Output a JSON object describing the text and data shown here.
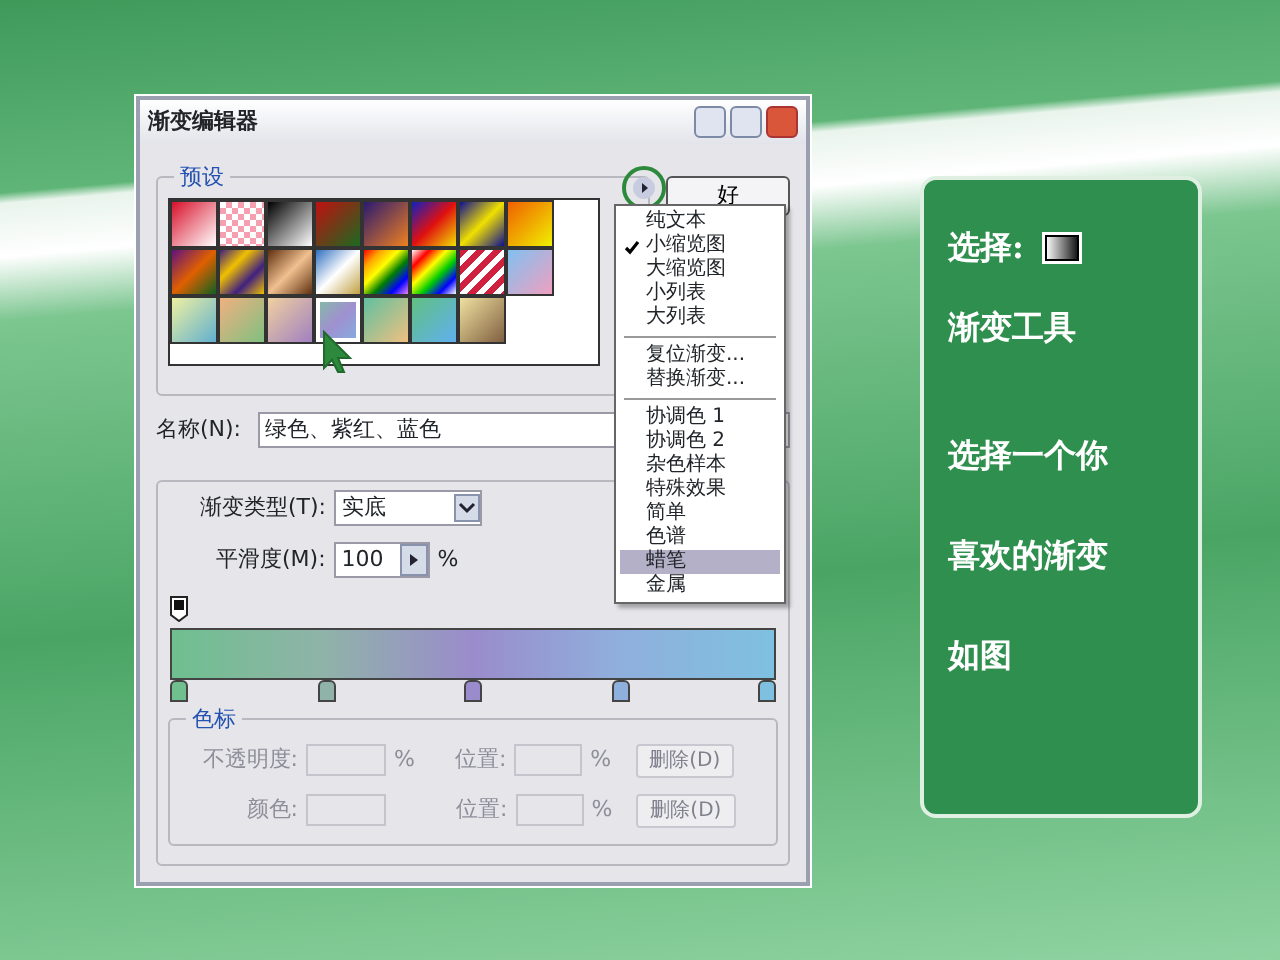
{
  "dialog": {
    "title": "渐变编辑器",
    "presets": {
      "legend": "预设",
      "items": [
        {
          "selected": false
        },
        {
          "selected": false
        },
        {
          "selected": false
        },
        {
          "selected": false
        },
        {
          "selected": false
        },
        {
          "selected": false
        },
        {
          "selected": false
        },
        {
          "selected": false
        },
        {
          "selected": false
        },
        {
          "selected": false
        },
        {
          "selected": false
        },
        {
          "selected": false
        },
        {
          "selected": false
        },
        {
          "selected": false
        },
        {
          "selected": false
        },
        {
          "selected": false
        },
        {
          "selected": false
        },
        {
          "selected": false
        },
        {
          "selected": false
        },
        {
          "selected": true
        },
        {
          "selected": false
        },
        {
          "selected": false
        },
        {
          "selected": false
        }
      ]
    },
    "ok_button": "好",
    "name": {
      "label": "名称(N):",
      "value": "绿色、紫红、蓝色"
    },
    "gradient_type": {
      "label": "渐变类型(T):",
      "value": "实底"
    },
    "smoothness": {
      "label": "平滑度(M):",
      "value": "100",
      "unit": "%"
    },
    "color_stops": [
      {
        "color": "#6fbf8f"
      },
      {
        "color": "#8fb3a8"
      },
      {
        "color": "#9a8ccc"
      },
      {
        "color": "#8fb0dc"
      },
      {
        "color": "#7fc0e0"
      }
    ],
    "stops_group": {
      "legend": "色标",
      "disabled": true,
      "rows": [
        {
          "label": "不透明度:",
          "unit": "%",
          "position_label": "位置:",
          "position_unit": "%",
          "delete": "删除(D)"
        },
        {
          "label": "颜色:",
          "unit": "",
          "position_label": "位置:",
          "position_unit": "%",
          "delete": "删除(D)"
        }
      ]
    }
  },
  "menu": [
    {
      "kind": "item",
      "label": "纯文本",
      "checked": false,
      "selected": false
    },
    {
      "kind": "item",
      "label": "小缩览图",
      "checked": true,
      "selected": false
    },
    {
      "kind": "item",
      "label": "大缩览图",
      "checked": false,
      "selected": false
    },
    {
      "kind": "item",
      "label": "小列表",
      "checked": false,
      "selected": false
    },
    {
      "kind": "item",
      "label": "大列表",
      "checked": false,
      "selected": false
    },
    {
      "kind": "separator"
    },
    {
      "kind": "item",
      "label": "复位渐变...",
      "checked": false,
      "selected": false
    },
    {
      "kind": "item",
      "label": "替换渐变...",
      "checked": false,
      "selected": false
    },
    {
      "kind": "separator"
    },
    {
      "kind": "item",
      "label": "协调色 1",
      "checked": false,
      "selected": false
    },
    {
      "kind": "item",
      "label": "协调色 2",
      "checked": false,
      "selected": false
    },
    {
      "kind": "item",
      "label": "杂色样本",
      "checked": false,
      "selected": false
    },
    {
      "kind": "item",
      "label": "特殊效果",
      "checked": false,
      "selected": false
    },
    {
      "kind": "item",
      "label": "简单",
      "checked": false,
      "selected": false
    },
    {
      "kind": "item",
      "label": "色谱",
      "checked": false,
      "selected": false
    },
    {
      "kind": "item",
      "label": "蜡笔",
      "checked": false,
      "selected": true
    },
    {
      "kind": "item",
      "label": "金属",
      "checked": false,
      "selected": false
    }
  ],
  "note": {
    "select_label": "选择:",
    "tool_name": "渐变工具",
    "lines": [
      "选择一个你",
      "喜欢的渐变",
      "如图"
    ]
  }
}
